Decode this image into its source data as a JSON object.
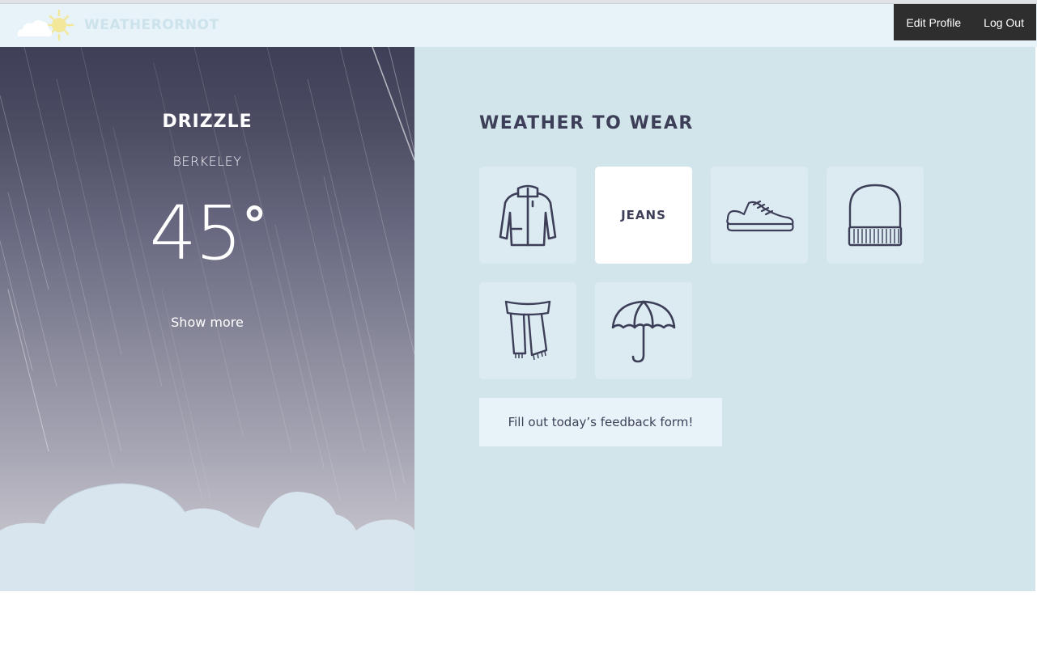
{
  "brand": {
    "name": "WEATHERORNOT",
    "icon": "cloud-sun-logo"
  },
  "nav": {
    "edit_profile": "Edit Profile",
    "log_out": "Log Out"
  },
  "weather": {
    "condition": "DRIZZLE",
    "city": "BERKELEY",
    "temperature": "45",
    "degree_symbol": "°",
    "show_more": "Show more"
  },
  "wear": {
    "title": "WEATHER TO WEAR",
    "items": [
      {
        "icon": "jacket-icon",
        "label": ""
      },
      {
        "icon": "",
        "label": "JEANS",
        "active": true
      },
      {
        "icon": "sneaker-icon",
        "label": ""
      },
      {
        "icon": "beanie-icon",
        "label": ""
      },
      {
        "icon": "scarf-icon",
        "label": ""
      },
      {
        "icon": "umbrella-icon",
        "label": ""
      }
    ],
    "feedback": "Fill out today’s feedback form!"
  },
  "colors": {
    "navbar_bg": "#e7f3f8",
    "nav_actions_bg": "#2e2e2e",
    "panel_dark": "#3e3f58",
    "wear_panel_bg": "#d2e5eb",
    "tile_bg": "#dcebf1",
    "text_dark": "#3d3f58"
  }
}
